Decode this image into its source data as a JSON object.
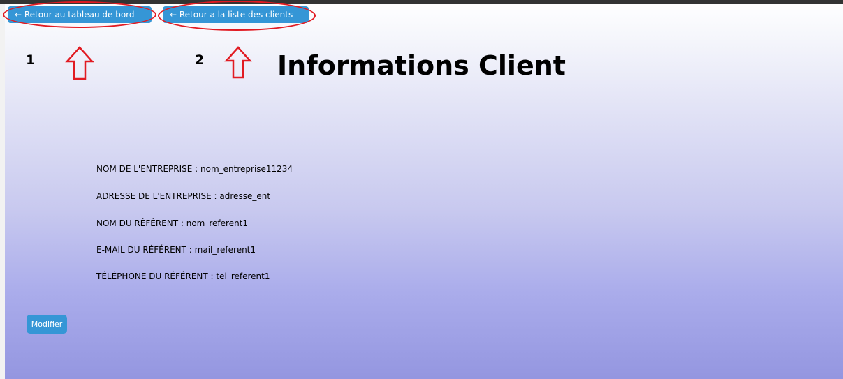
{
  "nav": {
    "back_dashboard": "← Retour au tableau de bord",
    "back_clients": "← Retour a la liste des clients"
  },
  "annotations": {
    "label_1": "1",
    "label_2": "2",
    "highlight_color": "#e11b22"
  },
  "page": {
    "title": "Informations Client"
  },
  "client": {
    "fields": [
      "NOM DE L'ENTREPRISE : nom_entreprise11234",
      "ADRESSE DE L'ENTREPRISE : adresse_ent",
      "NOM DU RÉFÉRENT : nom_referent1",
      "E-MAIL DU RÉFÉRENT : mail_referent1",
      "TÉLÉPHONE DU RÉFÉRENT : tel_referent1"
    ]
  },
  "actions": {
    "modify_label": "Modifier"
  },
  "colors": {
    "button": "#3596d6",
    "background_bottom": "#9496e0"
  }
}
